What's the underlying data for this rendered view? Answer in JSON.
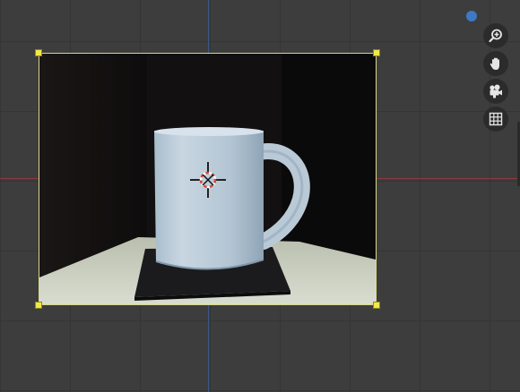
{
  "viewport": {
    "background_color": "#3d3d3d",
    "grid_color": "#353535",
    "axis_x_color": "#8a3a44",
    "axis_y_color": "#3c5a86"
  },
  "reference_image": {
    "subject": "white-mug-on-coaster",
    "frame_color": "#d8d88a",
    "handle_color": "#f2e84a"
  },
  "navigation_gizmo": {
    "buttons": [
      {
        "icon": "zoom-icon"
      },
      {
        "icon": "hand-pan-icon"
      },
      {
        "icon": "camera-icon"
      },
      {
        "icon": "grid-icon"
      }
    ],
    "indicator_color": "#3d79c5"
  }
}
